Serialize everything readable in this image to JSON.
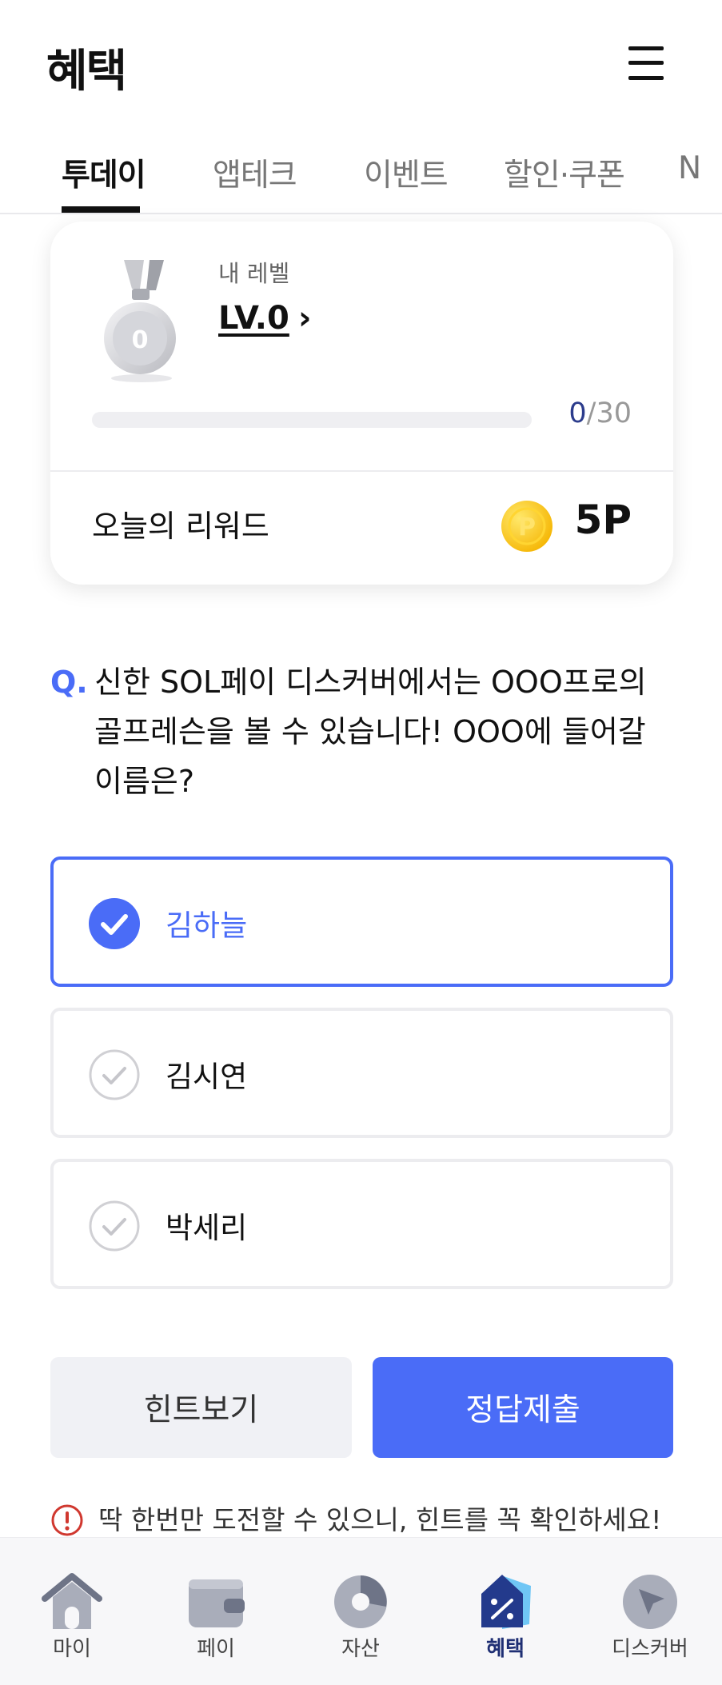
{
  "header": {
    "title": "혜택",
    "menu_icon": "hamburger-menu-icon"
  },
  "tabs": [
    {
      "label": "투데이",
      "active": true
    },
    {
      "label": "앱테크",
      "active": false
    },
    {
      "label": "이벤트",
      "active": false
    },
    {
      "label": "할인·쿠폰",
      "active": false
    },
    {
      "label": "N",
      "active": false
    }
  ],
  "level_card": {
    "medal_icon": "silver-medal-icon",
    "medal_number": "0",
    "caption": "내 레벨",
    "level": "LV.0",
    "level_chevron": "›",
    "progress_current": "0",
    "progress_total": "/30",
    "progress_fraction": 0,
    "reward_label": "오늘의 리워드",
    "reward_coin_icon": "point-coin-icon",
    "reward_coin_letter": "P",
    "reward_value": "5P"
  },
  "quiz": {
    "q_mark": "Q.",
    "question": "신한 SOL페이 디스커버에서는 OOO프로의 골프레슨을 볼 수 있습니다! OOO에 들어갈 이름은?",
    "options": [
      {
        "label": "김하늘",
        "selected": true
      },
      {
        "label": "김시연",
        "selected": false
      },
      {
        "label": "박세리",
        "selected": false
      }
    ],
    "hint_button": "힌트보기",
    "submit_button": "정답제출",
    "notice": "딱 한번만 도전할 수 있으니, 힌트를 꼭 확인하세요!"
  },
  "bottom_nav": [
    {
      "label": "마이",
      "icon": "home-icon",
      "active": false
    },
    {
      "label": "페이",
      "icon": "wallet-icon",
      "active": false
    },
    {
      "label": "자산",
      "icon": "pie-chart-icon",
      "active": false
    },
    {
      "label": "혜택",
      "icon": "benefit-tag-icon",
      "active": true
    },
    {
      "label": "디스커버",
      "icon": "compass-icon",
      "active": false
    }
  ],
  "colors": {
    "accent": "#4a6cf7",
    "text": "#111111",
    "muted": "#777777",
    "nav_active": "#1f2f74"
  }
}
